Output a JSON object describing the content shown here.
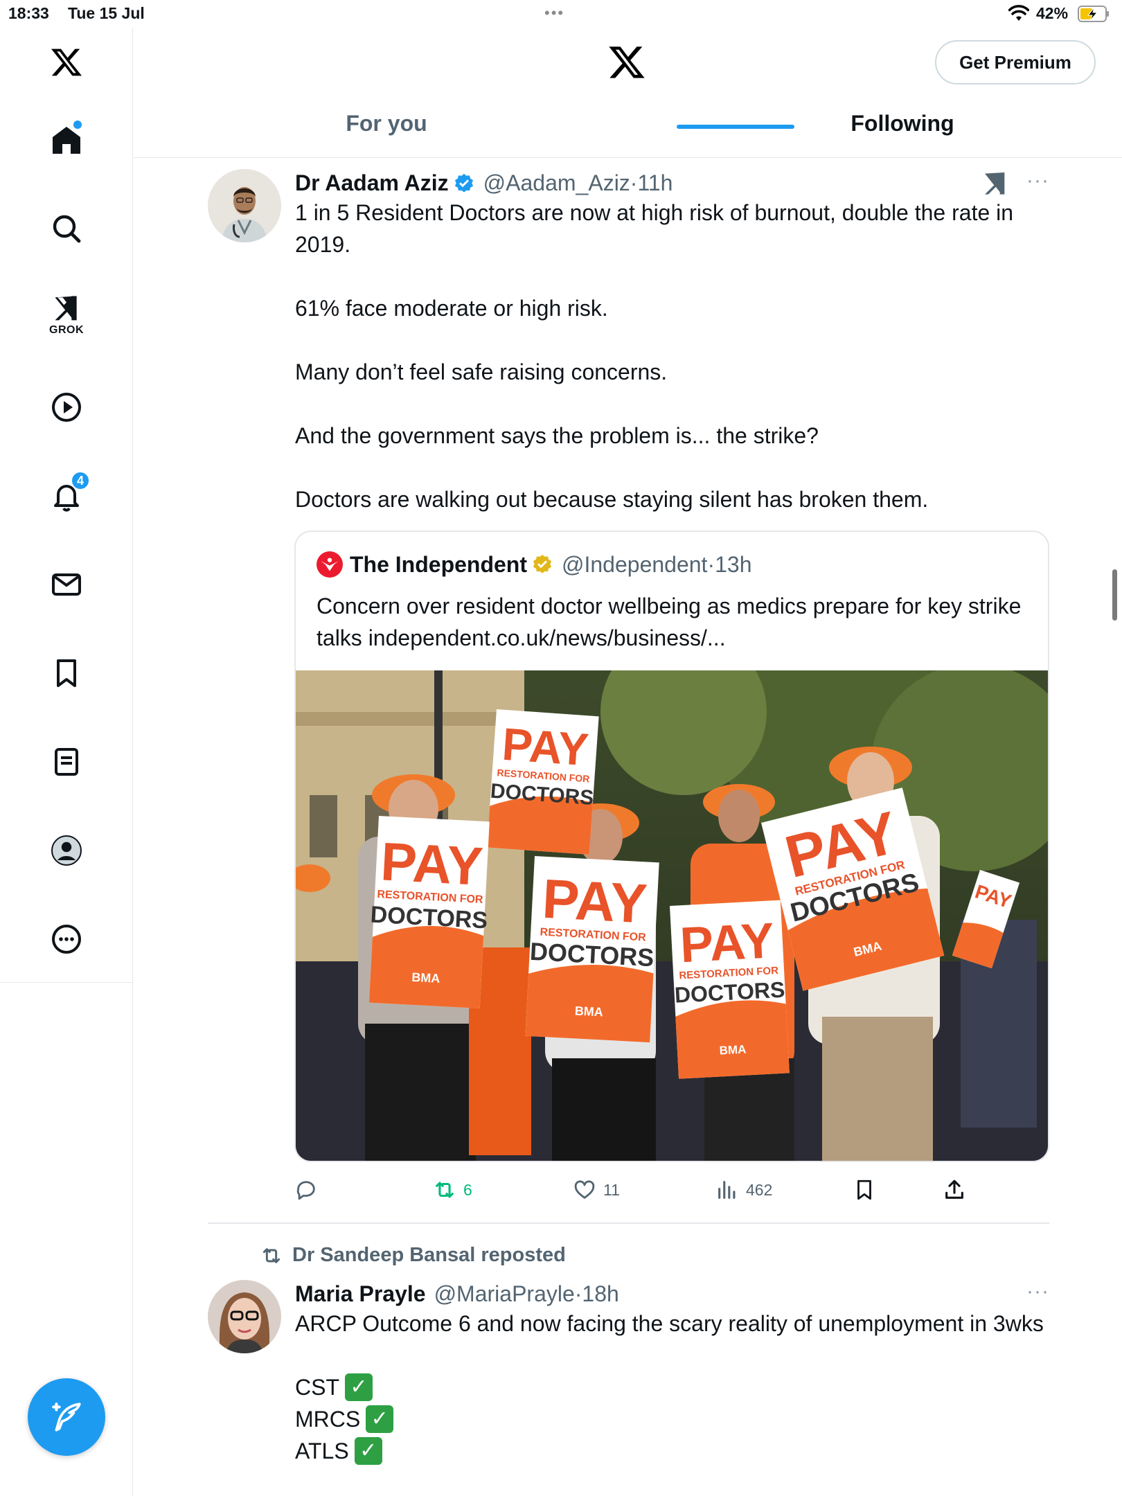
{
  "status_bar": {
    "time": "18:33",
    "date": "Tue 15 Jul",
    "dots": "•••",
    "battery": "42%"
  },
  "sidebar": {
    "items": [
      {
        "icon": "x-logo-icon"
      },
      {
        "icon": "home-icon"
      },
      {
        "icon": "search-icon"
      },
      {
        "icon": "grok-icon",
        "label": "GROK"
      },
      {
        "icon": "video-play-icon"
      },
      {
        "icon": "bell-icon",
        "badge": "4"
      },
      {
        "icon": "mail-icon"
      },
      {
        "icon": "bookmark-icon"
      },
      {
        "icon": "list-icon"
      },
      {
        "icon": "profile-icon"
      },
      {
        "icon": "more-circle-icon"
      }
    ],
    "compose_icon": "compose-feather-icon"
  },
  "header": {
    "premium_label": "Get Premium",
    "tabs": [
      {
        "label": "For you"
      },
      {
        "label": "Following"
      }
    ],
    "active_tab": "Following"
  },
  "tweets": [
    {
      "name": "Dr Aadam Aziz",
      "handle": "@Aadam_Aziz",
      "time": "·11h",
      "more": "···",
      "paragraphs": [
        "1 in 5 Resident Doctors are now at high risk of burnout, double the rate in 2019.",
        "61% face moderate or high risk.",
        "Many don’t feel safe raising concerns.",
        "And the government says the problem is... the strike?",
        "Doctors are walking out because staying silent has broken them."
      ],
      "quote": {
        "name": "The Independent",
        "handle": "@Independent",
        "time": "·13h",
        "text": "Concern over resident doctor wellbeing as medics prepare for key strike talks independent.co.uk/news/business/...",
        "image": {
          "signs": [
            {
              "big": "PAY",
              "small": "RESTORATION FOR",
              "mid": "DOCTORS",
              "foot": "BMA"
            }
          ]
        }
      },
      "actions": {
        "replies": "",
        "reposts": "6",
        "likes": "11",
        "views": "462"
      }
    },
    {
      "repost_by": "Dr Sandeep Bansal reposted",
      "name": "Maria Prayle",
      "handle": "@MariaPrayle",
      "time": "·18h",
      "more": "···",
      "paragraphs": [
        "ARCP Outcome 6 and now facing the scary reality of unemployment in 3wks"
      ],
      "checklist": [
        "CST",
        "MRCS",
        "ATLS"
      ],
      "check_glyph": "✓"
    }
  ],
  "colors": {
    "accent": "#1d9bf0",
    "retweet_green": "#00ba7c",
    "sign_orange": "#f26a2b",
    "muted": "#536471"
  }
}
